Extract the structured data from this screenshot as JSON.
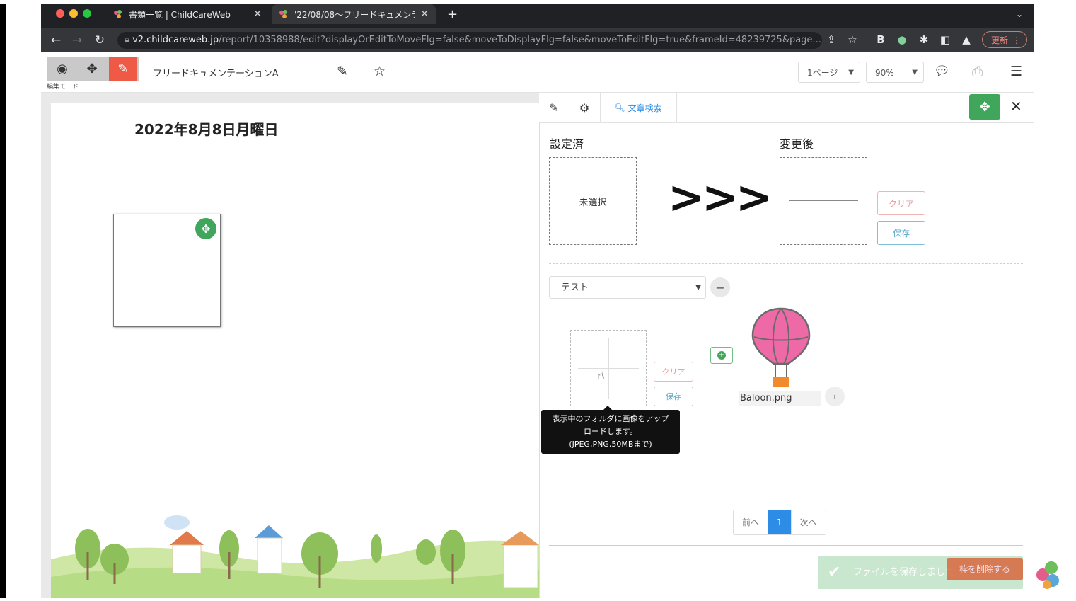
{
  "browser": {
    "tabs": [
      {
        "title": "書類一覧 | ChildCareWeb"
      },
      {
        "title": "'22/08/08〜フリードキュメンテ…"
      }
    ],
    "new_tab_label": "+",
    "url_host": "v2.childcareweb.jp",
    "url_path": "/report/10358988/edit?displayOrEditToMoveFlg=false&moveToDisplayFlg=false&moveToEditFlg=true&frameId=48239725&page...",
    "update_label": "更新"
  },
  "toolbar": {
    "mode_label": "編集モード",
    "doc_title": "フリードキュメンテーションA",
    "page_select": "1ページ",
    "zoom_select": "90%"
  },
  "canvas": {
    "date_text": "2022年8月8日月曜日"
  },
  "panel": {
    "search_label": "文章検索",
    "current_label": "設定済",
    "after_label": "変更後",
    "unselected_text": "未選択",
    "arrows": ">>>",
    "clear_label": "クリア",
    "save_label": "保存",
    "folder_value": "テスト",
    "upload_clear_label": "クリア",
    "upload_save_label": "保存",
    "tooltip": {
      "line1": "表示中のフォルダに画像をアップ",
      "line2": "ロードします。",
      "line3": "(JPEG,PNG,50MBまで)"
    },
    "image_file": "Baloon.png",
    "pagination": {
      "prev": "前へ",
      "current": "1",
      "next": "次へ"
    },
    "toast_text": "ファイルを保存しました",
    "delete_frame_label": "枠を削除する"
  },
  "colors": {
    "accent_green": "#3fa65b",
    "edit_red": "#ee5a45",
    "page_blue": "#2c8ce6",
    "balloon_pink": "#ee6aa7"
  }
}
